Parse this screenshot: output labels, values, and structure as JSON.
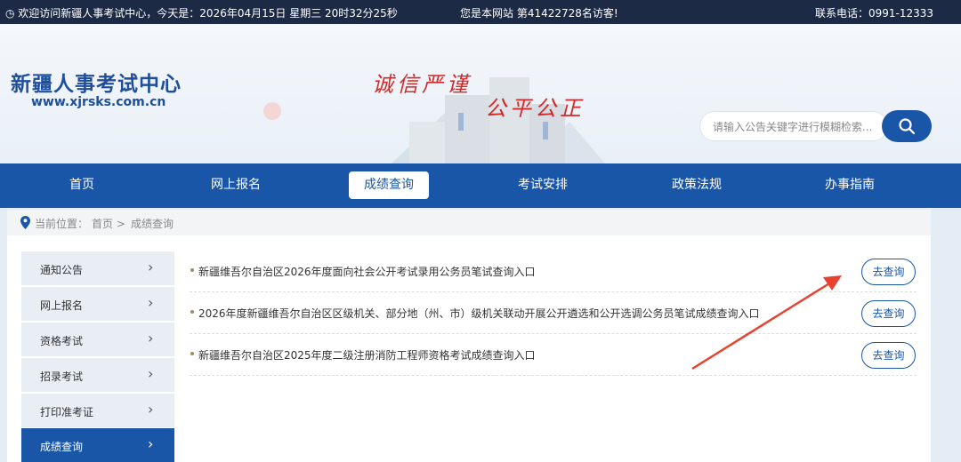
{
  "topbar": {
    "welcome": "欢迎访问新疆人事考试中心，今天是：2026年04月15日 星期三 20时32分25秒",
    "visitors": "您是本网站 第41422728名访客!",
    "phone": "联系电话：0991-12333"
  },
  "header": {
    "title": "新疆人事考试中心",
    "url": "www.xjrsks.com.cn",
    "slogan1": "诚信严谨",
    "slogan2": "公平公正",
    "search_placeholder": "请输入公告关键字进行模糊检索..."
  },
  "nav": [
    {
      "label": "首页"
    },
    {
      "label": "网上报名"
    },
    {
      "label": "成绩查询"
    },
    {
      "label": "考试安排"
    },
    {
      "label": "政策法规"
    },
    {
      "label": "办事指南"
    }
  ],
  "breadcrumb": {
    "prefix": "当前位置：",
    "home": "首页 >",
    "current": "成绩查询"
  },
  "sidebar": [
    {
      "label": "通知公告"
    },
    {
      "label": "网上报名"
    },
    {
      "label": "资格考试"
    },
    {
      "label": "招录考试"
    },
    {
      "label": "打印准考证"
    },
    {
      "label": "成绩查询"
    }
  ],
  "list": [
    {
      "title": "新疆维吾尔自治区2026年度面向社会公开考试录用公务员笔试查询入口",
      "button": "去查询"
    },
    {
      "title": "2026年度新疆维吾尔自治区区级机关、部分地（州、市）级机关联动开展公开遴选和公开选调公务员笔试成绩查询入口",
      "button": "去查询"
    },
    {
      "title": "新疆维吾尔自治区2025年度二级注册消防工程师资格考试成绩查询入口",
      "button": "去查询"
    }
  ],
  "colors": {
    "primary": "#1a56a8",
    "topbar": "#1c2a45",
    "slogan": "#d02a2a",
    "arrow": "#e8412f"
  }
}
